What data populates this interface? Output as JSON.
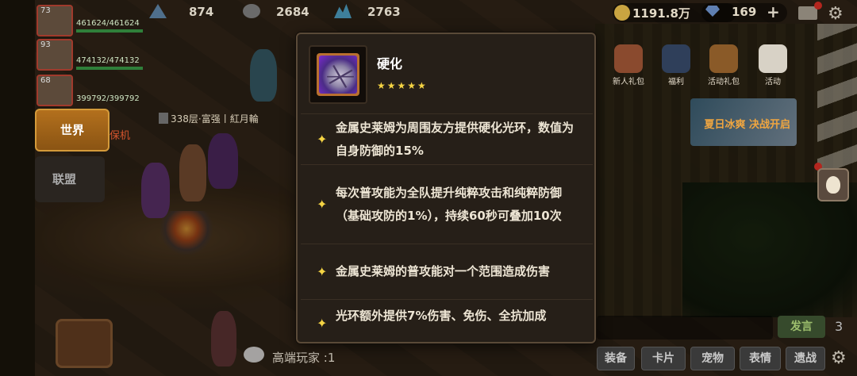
{
  "hud": {
    "res1_value": "874",
    "res2_value": "2684",
    "res3_value": "2763",
    "gold_value": "1191.8万",
    "gem_value": "169",
    "gem_plus": "+"
  },
  "party": [
    {
      "level": "73",
      "hp": "461624/461624"
    },
    {
      "level": "93",
      "hp": "474132/474132"
    },
    {
      "level": "68",
      "hp": "399792/399792"
    }
  ],
  "nav": {
    "world_label": "世界",
    "alliance_label": "联盟"
  },
  "scene": {
    "guild_tag": "338层·富强丨紅月輪",
    "player_name": "保机"
  },
  "events": {
    "newbie_pack": "新人礼包",
    "welfare": "福利",
    "activity_pack": "活动礼包",
    "activity": "活动",
    "banner_text": "夏日冰爽 决战开启"
  },
  "skill": {
    "name": "硬化",
    "stars": "★★★★★",
    "effects": [
      "金属史莱姆为周围友方提供硬化光环，数值为自身防御的15%",
      "每次普攻能为全队提升纯粹攻击和纯粹防御（基础攻防的1%），持续60秒可叠加10次",
      "金属史莱姆的普攻能对一个范围造成伤害",
      "光环额外提供7%伤害、免伤、全抗加成"
    ]
  },
  "chat": {
    "message": "高端玩家 :1",
    "send_label": "发言",
    "count": "3"
  },
  "bottom_buttons": {
    "equipment": "装备",
    "card": "卡片",
    "pet": "宠物",
    "emote": "表情",
    "away": "遗战"
  }
}
